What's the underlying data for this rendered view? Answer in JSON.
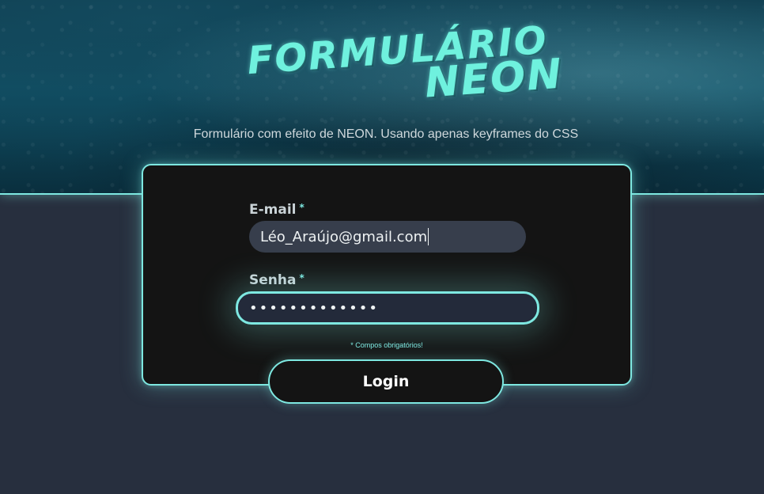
{
  "header": {
    "title_line1": "Formulário",
    "title_line2": "Neon",
    "subtitle": "Formulário com efeito de NEON. Usando apenas keyframes do CSS"
  },
  "form": {
    "email": {
      "label": "E-mail",
      "required_mark": "*",
      "value": "Léo_Araújo@gmail.com"
    },
    "password": {
      "label": "Senha",
      "required_mark": "*",
      "value": "•••••••••••••"
    },
    "required_note": "* Compos obrigatórios!",
    "submit_label": "Login"
  },
  "colors": {
    "accent": "#7ee8e1",
    "title": "#6ff1de",
    "card": "#141414",
    "page_bg": "#272f3e"
  }
}
